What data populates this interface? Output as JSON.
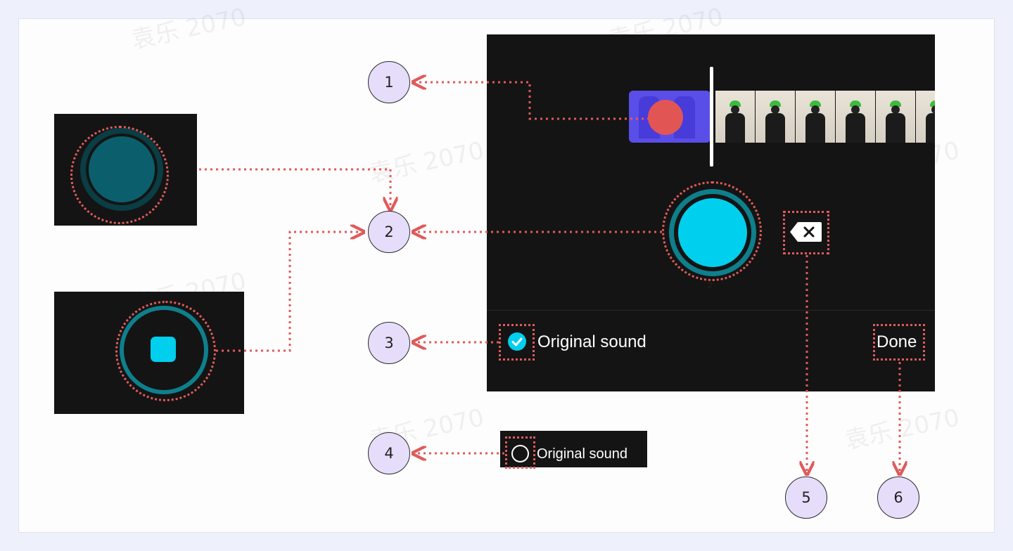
{
  "watermark_text": "袁乐 2070",
  "callouts": [
    "1",
    "2",
    "3",
    "4",
    "5",
    "6"
  ],
  "main_screen": {
    "original_sound_label": "Original sound",
    "done_label": "Done",
    "record_button_caption": "2"
  },
  "unchecked_variant": {
    "original_sound_label": "Original sound"
  },
  "colors": {
    "annotation_red": "#e05a5a",
    "callout_fill": "#e6ddfb",
    "record_cyan": "#00cfee",
    "record_ring_teal": "#0f7f8c",
    "disabled_record": "#0b5f6c",
    "clip_highlight": "#5a4ee8",
    "dark_bg": "#141414"
  },
  "icons": {
    "record_dot": "record-dot-icon",
    "delete_clip": "backspace-x-icon",
    "checkbox_checked": "checkmark-circle-icon",
    "checkbox_unchecked": "empty-circle-icon",
    "stop": "stop-square-icon"
  }
}
